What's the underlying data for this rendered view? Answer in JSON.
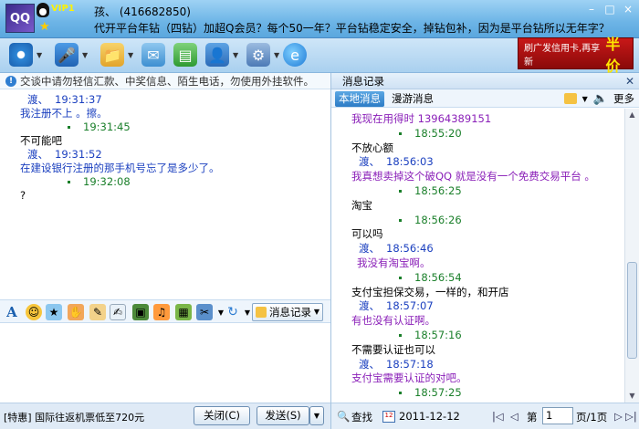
{
  "header": {
    "vip_label": "VIP1",
    "contact_name": "孩、 (416682850)",
    "contact_signature": "代开平台年钻（四钻）加超Q会员？每个50一年？平台钻稳定安全，掉钻包补，因为是平台钻所以无年字？",
    "ad_text": "刷广发信用卡,再享新",
    "ad_big": "半价"
  },
  "left": {
    "notice": "交谈中请勿轻信汇款、中奖信息、陌生电话，勿使用外挂软件。",
    "messages": [
      {
        "type": "header",
        "sender": "渡、",
        "time": "19:31:37"
      },
      {
        "type": "text",
        "text": "我注册不上 。擦。",
        "color": "blue"
      },
      {
        "type": "stamp",
        "time": "19:31:45"
      },
      {
        "type": "text",
        "text": "不可能吧",
        "color": "black"
      },
      {
        "type": "header",
        "sender": "渡、",
        "time": "19:31:52"
      },
      {
        "type": "text",
        "text": "在建设银行注册的那手机号忘了是多少了。",
        "color": "blue"
      },
      {
        "type": "stamp",
        "time": "19:32:08"
      },
      {
        "type": "text",
        "text": "?",
        "color": "black"
      }
    ],
    "msg_record_label": "消息记录",
    "promo_text": "[特惠] 国际往返机票低至720元",
    "close_label": "关闭(C)",
    "send_label": "发送(S)"
  },
  "right": {
    "title": "消息记录",
    "tab_local": "本地消息",
    "tab_roam": "漫游消息",
    "more_label": "更多",
    "messages": [
      {
        "type": "text",
        "text": "我现在用得时 13964389151",
        "color": "purple"
      },
      {
        "type": "stamp",
        "time": "18:55:20"
      },
      {
        "type": "text",
        "text": "不放心额",
        "color": "black"
      },
      {
        "type": "header",
        "sender": "渡、",
        "time": "18:56:03"
      },
      {
        "type": "text",
        "text": "我真想卖掉这个破QQ 就是没有一个免费交易平台 。",
        "color": "purple"
      },
      {
        "type": "stamp",
        "time": "18:56:25"
      },
      {
        "type": "text",
        "text": "淘宝",
        "color": "black"
      },
      {
        "type": "stamp",
        "time": "18:56:26"
      },
      {
        "type": "text",
        "text": "可以吗",
        "color": "black"
      },
      {
        "type": "header",
        "sender": "渡、",
        "time": "18:56:46"
      },
      {
        "type": "text",
        "text": "我没有淘宝啊。",
        "color": "purple",
        "indent": true
      },
      {
        "type": "stamp",
        "time": "18:56:54"
      },
      {
        "type": "text",
        "text": "支付宝担保交易，一样的，和开店",
        "color": "black"
      },
      {
        "type": "header",
        "sender": "渡、",
        "time": "18:57:07"
      },
      {
        "type": "text",
        "text": "有也没有认证啊。",
        "color": "purple"
      },
      {
        "type": "stamp",
        "time": "18:57:16"
      },
      {
        "type": "text",
        "text": "不需要认证也可以",
        "color": "black"
      },
      {
        "type": "header",
        "sender": "渡、",
        "time": "18:57:18"
      },
      {
        "type": "text",
        "text": "支付宝需要认证的对吧。",
        "color": "purple"
      },
      {
        "type": "stamp",
        "time": "18:57:25"
      }
    ],
    "search_label": "查找",
    "date": "2011-12-12",
    "page_prefix": "第",
    "page_value": "1",
    "page_suffix": "页/1页"
  }
}
